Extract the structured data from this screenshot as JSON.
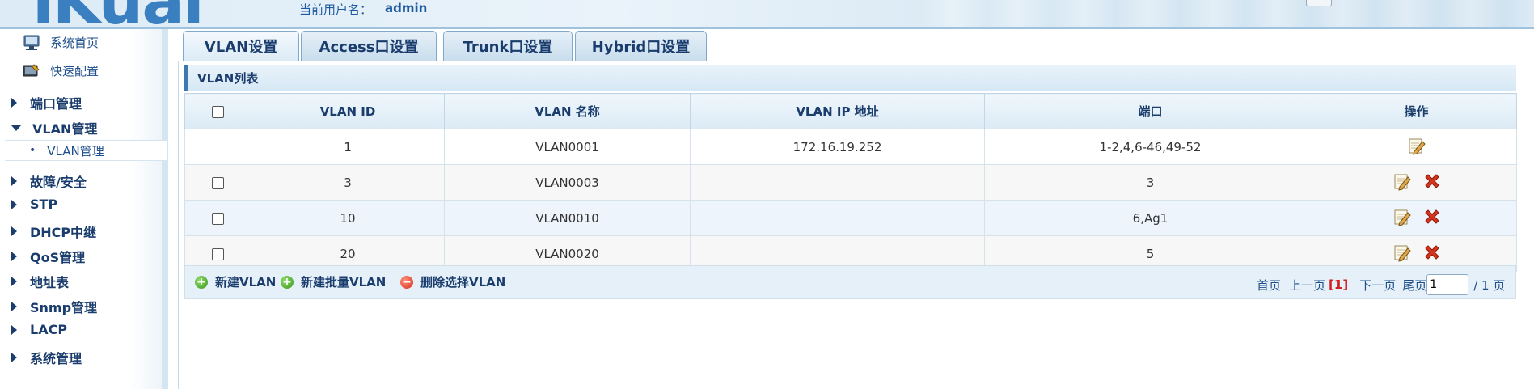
{
  "header": {
    "logo_text": "iKuai",
    "user_label": "当前用户名：",
    "user_name": "admin"
  },
  "sidebar": {
    "top_links": [
      {
        "label": "系统首页",
        "icon": "monitor-icon"
      },
      {
        "label": "快速配置",
        "icon": "wizard-icon"
      }
    ],
    "items": [
      {
        "label": "端口管理",
        "expanded": false
      },
      {
        "label": "VLAN管理",
        "expanded": true
      },
      {
        "label": "故障/安全",
        "expanded": false
      },
      {
        "label": "STP",
        "expanded": false
      },
      {
        "label": "DHCP中继",
        "expanded": false
      },
      {
        "label": "QoS管理",
        "expanded": false
      },
      {
        "label": "地址表",
        "expanded": false
      },
      {
        "label": "Snmp管理",
        "expanded": false
      },
      {
        "label": "LACP",
        "expanded": false
      },
      {
        "label": "系统管理",
        "expanded": false
      }
    ],
    "sub_item": {
      "label": "VLAN管理",
      "bullet": "•"
    }
  },
  "tabs": [
    {
      "label": "VLAN设置",
      "active": true
    },
    {
      "label": "Access口设置",
      "active": false
    },
    {
      "label": "Trunk口设置",
      "active": false
    },
    {
      "label": "Hybrid口设置",
      "active": false
    }
  ],
  "list": {
    "title": "VLAN列表",
    "columns": [
      "VLAN ID",
      "VLAN 名称",
      "VLAN IP 地址",
      "端口",
      "操作"
    ],
    "rows": [
      {
        "id": "1",
        "name": "VLAN0001",
        "ip": "172.16.19.252",
        "ports": "1-2,4,6-46,49-52",
        "deletable": false
      },
      {
        "id": "3",
        "name": "VLAN0003",
        "ip": "",
        "ports": "3",
        "deletable": true
      },
      {
        "id": "10",
        "name": "VLAN0010",
        "ip": "",
        "ports": "6,Ag1",
        "deletable": true
      },
      {
        "id": "20",
        "name": "VLAN0020",
        "ip": "",
        "ports": "5",
        "deletable": true
      }
    ]
  },
  "footer": {
    "new_vlan": "新建VLAN",
    "batch_new_vlan": "新建批量VLAN",
    "delete_selected": "删除选择VLAN"
  },
  "pager": {
    "first": "首页",
    "prev": "上一页",
    "current": "[1]",
    "next": "下一页",
    "last": "尾页",
    "page_input_value": "1",
    "total": "/ 1 页"
  },
  "colors": {
    "accent": "#3c78b4",
    "text_dark": "#1a3d6d",
    "current_page": "#d02020",
    "delete_red": "#d6341c",
    "add_green": "#3b9a1f"
  }
}
